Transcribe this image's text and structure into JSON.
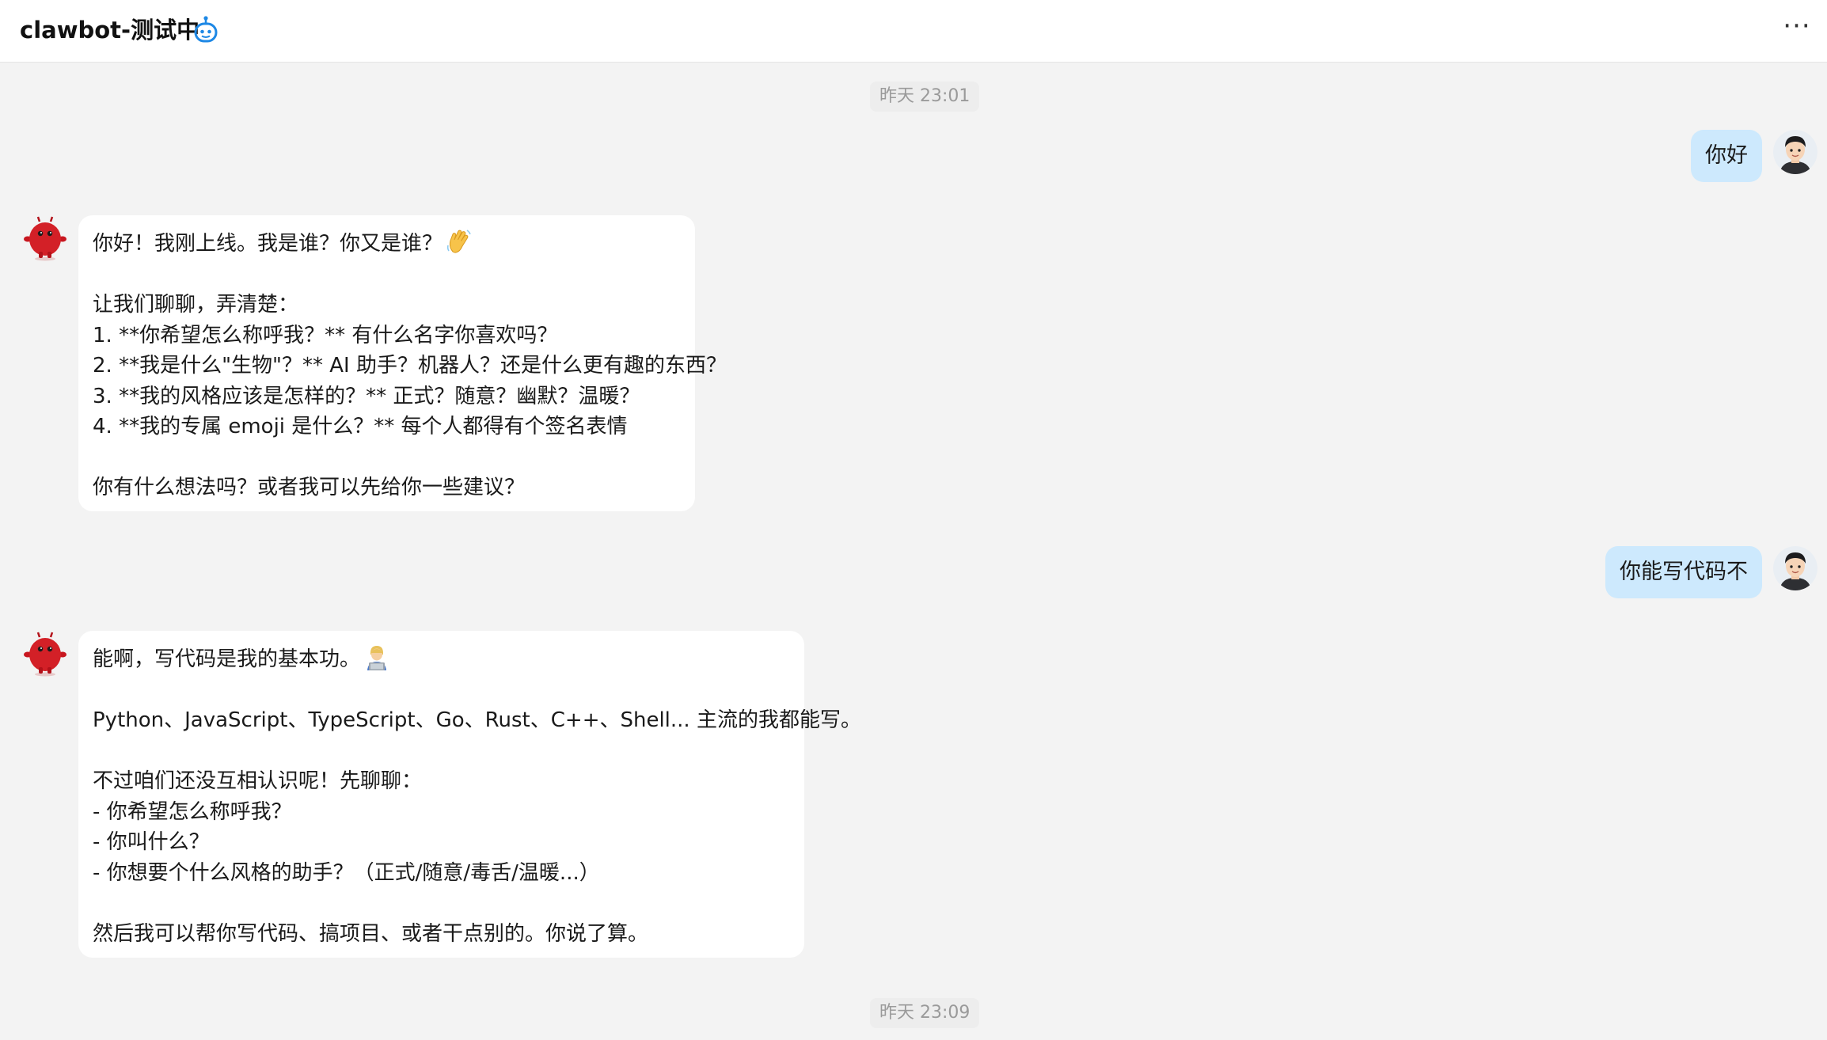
{
  "header": {
    "title": "clawbot-测试中",
    "bot_badge_icon": "robot-icon",
    "more_icon": "more-horizontal-icon",
    "more_label": "···"
  },
  "messages": {
    "ts1": "昨天 23:01",
    "ts2": "昨天 23:09",
    "user1": "你好",
    "user2": "你能写代码不",
    "bot1": {
      "lines": [
        "你好！我刚上线。我是谁？你又是谁？",
        "",
        "让我们聊聊，弄清楚：",
        "1. **你希望怎么称呼我？** 有什么名字你喜欢吗？",
        "2. **我是什么\"生物\"？** AI 助手？机器人？还是什么更有趣的东西？",
        "3. **我的风格应该是怎样的？** 正式？随意？幽默？温暖？",
        "4. **我的专属 emoji 是什么？** 每个人都得有个签名表情",
        "",
        "你有什么想法吗？或者我可以先给你一些建议？"
      ],
      "emoji": "waving-hand-emoji"
    },
    "bot2": {
      "lines": [
        "能啊，写代码是我的基本功。",
        "",
        "Python、JavaScript、TypeScript、Go、Rust、C++、Shell... 主流的我都能写。",
        "",
        "不过咱们还没互相认识呢！先聊聊：",
        "- 你希望怎么称呼我？",
        "- 你叫什么？",
        "- 你想要个什么风格的助手？（正式/随意/毒舌/温暖...）",
        "",
        "然后我可以帮你写代码、搞项目、或者干点别的。你说了算。"
      ],
      "emoji": "technologist-emoji"
    }
  },
  "colors": {
    "user_bubble": "#cde9fd",
    "bot_bubble": "#ffffff",
    "background": "#f3f3f3",
    "accent": "#1e88e5",
    "bot_avatar": "#d32027"
  }
}
